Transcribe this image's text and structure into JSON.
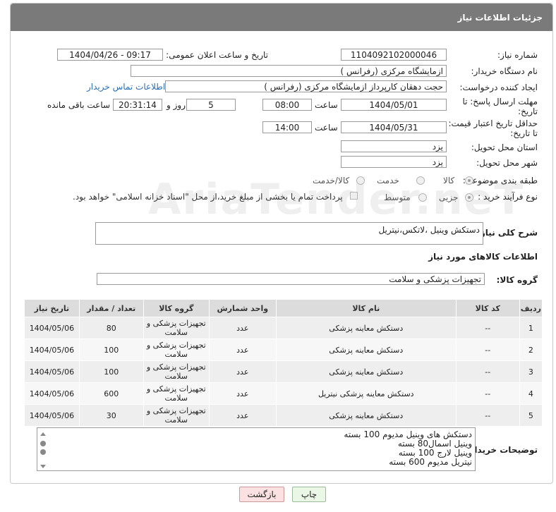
{
  "header": {
    "title": "جزئیات اطلاعات نیاز"
  },
  "labels": {
    "need_number": "شماره نیاز:",
    "announce_datetime": "تاریخ و ساعت اعلان عمومی:",
    "buyer_org": "نام دستگاه خریدار:",
    "requester": "ایجاد کننده درخواست:",
    "contact_link": "اطلاعات تماس خریدار",
    "deadline": "مهلت ارسال پاسخ: تا تاریخ:",
    "hour": "ساعت",
    "day_and": "روز و",
    "hours_left": "ساعت باقی مانده",
    "min_validity": "حداقل تاریخ اعتبار قیمت: تا تاریخ:",
    "delivery_province": "استان محل تحویل:",
    "delivery_city": "شهر محل تحویل:",
    "category": "طبقه بندی موضوعی:",
    "process_type": "نوع فرآیند خرید :",
    "description": "شرح کلی نیاز:",
    "goods_info": "اطلاعات کالاهای مورد نیاز",
    "goods_group": "گروه کالا:",
    "buyer_notes": "توضیحات خریدار:"
  },
  "values": {
    "need_number": "1104092102000046",
    "announce_datetime": "1404/04/26 - 09:17",
    "buyer_org": "ازمایشگاه مرکزی (رفرانس )",
    "requester": "حجت دهقان کارپرداز ازمایشگاه مرکزی (رفرانس )",
    "deadline_date": "1404/05/01",
    "deadline_time": "08:00",
    "days": "5",
    "remaining_time": "20:31:14",
    "validity_date": "1404/05/31",
    "validity_time": "14:00",
    "delivery_province": "یزد",
    "delivery_city": "یزد",
    "description": "دستکش وینیل ،لاتکس،نیتریل",
    "goods_group": "تجهیزات پزشکی و سلامت"
  },
  "category_options": [
    {
      "label": "کالا",
      "selected": true
    },
    {
      "label": "خدمت",
      "selected": false
    },
    {
      "label": "کالا/خدمت",
      "selected": false
    }
  ],
  "process_options": [
    {
      "label": "جزیی",
      "selected": true
    },
    {
      "label": "متوسط",
      "selected": false
    }
  ],
  "payment_note": "پرداخت تمام یا بخشی از مبلغ خرید،از محل \"اسناد خزانه اسلامی\" خواهد بود.",
  "table": {
    "headers": [
      "ردیف",
      "کد کالا",
      "نام کالا",
      "واحد شمارش",
      "گروه کالا",
      "تعداد / مقدار",
      "تاریخ نیاز"
    ],
    "rows": [
      [
        "1",
        "--",
        "دستکش معاینه پزشکی",
        "عدد",
        "تجهیزات پزشکی و سلامت",
        "80",
        "1404/05/06"
      ],
      [
        "2",
        "--",
        "دستکش معاینه پزشکی",
        "عدد",
        "تجهیزات پزشکی و سلامت",
        "100",
        "1404/05/06"
      ],
      [
        "3",
        "--",
        "دستکش معاینه پزشکی",
        "عدد",
        "تجهیزات پزشکی و سلامت",
        "100",
        "1404/05/06"
      ],
      [
        "4",
        "--",
        "دستکش معاینه پزشکی نیتریل",
        "عدد",
        "تجهیزات پزشکی و سلامت",
        "600",
        "1404/05/06"
      ],
      [
        "5",
        "--",
        "دستکش معاینه پزشکی",
        "عدد",
        "تجهیزات پزشکی و سلامت",
        "30",
        "1404/05/06"
      ]
    ]
  },
  "notes_lines": [
    "دستکش های وینیل مدیوم 100 بسته",
    "وینیل اسمال80 بسته",
    "وینیل لارج 100 بسته",
    "نیتریل مدیوم 600 بسته"
  ],
  "buttons": {
    "print": "چاپ",
    "back": "بازگشت"
  },
  "watermark": "AriaTender.neT"
}
